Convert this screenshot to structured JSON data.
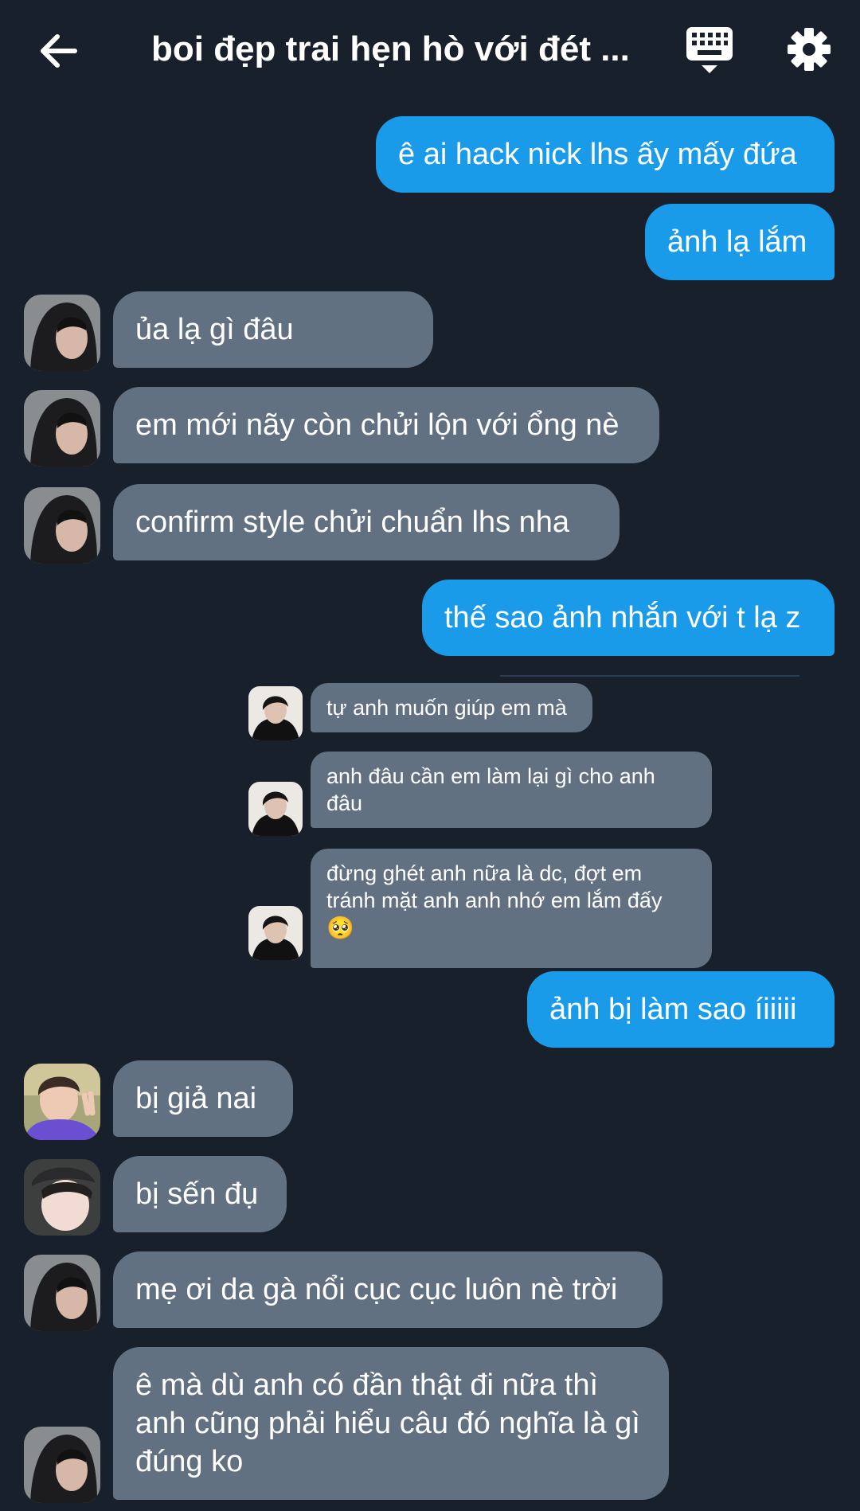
{
  "header": {
    "title": "boi đẹp trai hẹn hò với đét ...",
    "back_icon": "arrow-left-icon",
    "keyboard_icon": "keyboard-icon",
    "settings_icon": "gear-icon"
  },
  "colors": {
    "background": "#17202b",
    "outgoing_bubble": "#1a9bea",
    "incoming_bubble": "#627182"
  },
  "messages": [
    {
      "side": "out",
      "text": "ê ai hack nick lhs ấy mấy đứa"
    },
    {
      "side": "out",
      "text": "ảnh lạ lắm"
    },
    {
      "side": "in",
      "text": "ủa lạ gì đâu"
    },
    {
      "side": "in",
      "text": "em mới nãy còn chửi lộn với ổng nè"
    },
    {
      "side": "in",
      "text": "confirm style chửi chuẩn lhs nha"
    },
    {
      "side": "out",
      "text": "thế sao ảnh nhắn với t lạ z"
    },
    {
      "side": "out",
      "text": "ảnh bị làm sao íiiiii"
    },
    {
      "side": "in",
      "text": "bị giả nai"
    },
    {
      "side": "in",
      "text": "bị sến đụ"
    },
    {
      "side": "in",
      "text": "mẹ ơi da gà nổi cục cục luôn nè trời"
    },
    {
      "side": "in",
      "text": "ê mà dù anh có đần thật đi nữa thì anh cũng phải hiểu câu đó nghĩa là gì đúng ko"
    }
  ],
  "embedded_screenshot": {
    "messages": [
      {
        "text": "tự anh muốn giúp em mà"
      },
      {
        "text": "anh đâu cần em làm lại gì cho anh đâu"
      },
      {
        "text": "đừng ghét anh nữa là dc, đợt em tránh mặt anh anh nhớ em lắm đấy"
      }
    ],
    "emoji": "🥺"
  }
}
